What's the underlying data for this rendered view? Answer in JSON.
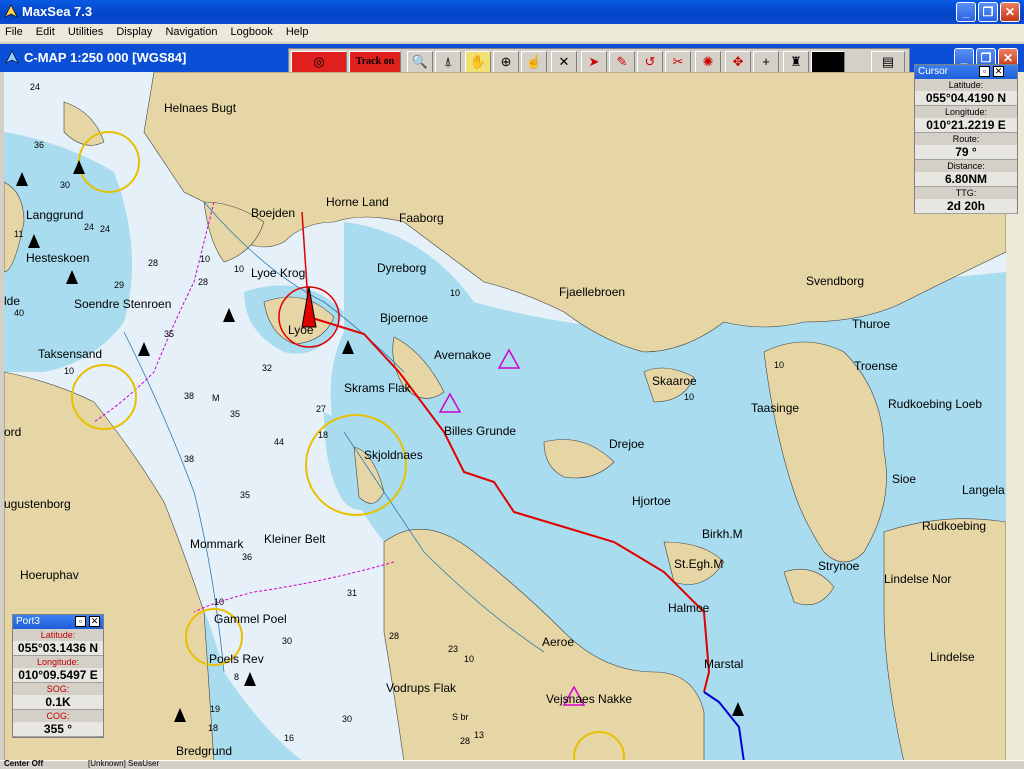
{
  "app": {
    "title": "MaxSea 7.3"
  },
  "menu": [
    "File",
    "Edit",
    "Utilities",
    "Display",
    "Navigation",
    "Logbook",
    "Help"
  ],
  "chart_window": {
    "title": "C-MAP  1:250 000 [WGS84]"
  },
  "toolbar": {
    "track_label": "Track on"
  },
  "cursor_panel": {
    "title": "Cursor",
    "lat_label": "Latitude:",
    "lat": "055°04.4190 N",
    "lon_label": "Longitude:",
    "lon": "010°21.2219 E",
    "route_label": "Route:",
    "route": "79 °",
    "dist_label": "Distance:",
    "dist": "6.80NM",
    "ttg_label": "TTG:",
    "ttg": "2d 20h"
  },
  "port_panel": {
    "title": "Port3",
    "lat_label": "Latitude:",
    "lat": "055°03.1436 N",
    "lon_label": "Longitude:",
    "lon": "010°09.5497 E",
    "sog_label": "SOG:",
    "sog": "0.1K",
    "cog_label": "COG:",
    "cog": "355 °"
  },
  "status": {
    "left": "Center Off",
    "user": "[Unknown] SeaUser"
  },
  "places": {
    "helnaes_bugt": "Helnaes Bugt",
    "horne_land": "Horne Land",
    "faaborg": "Faaborg",
    "boejden": "Boejden",
    "lyoe_krog": "Lyoe Krog",
    "lyoe": "Lyoe",
    "dyreborg": "Dyreborg",
    "bjoernoe": "Bjoernoe",
    "fjaellebroen": "Fjaellebroen",
    "svendborg": "Svendborg",
    "thuroe": "Thuroe",
    "troense": "Troense",
    "avernakoe": "Avernakoe",
    "skaaroe": "Skaaroe",
    "taasinge": "Taasinge",
    "rudkoebing_loeb": "Rudkoebing Loeb",
    "skrams_flak": "Skrams Flak",
    "billes_grunde": "Billes Grunde",
    "drejoe": "Drejoe",
    "skjoldnaes": "Skjoldnaes",
    "hjortoe": "Hjortoe",
    "sioe": "Sioe",
    "langela": "Langela",
    "birkh": "Birkh.M",
    "st_egh": "St.Egh.M",
    "strynoe": "Strynoe",
    "rudkoebing": "Rudkoebing",
    "lindelse_nor": "Lindelse Nor",
    "halmoe": "Halmoe",
    "aeroe": "Aeroe",
    "marstal": "Marstal",
    "lindelse": "Lindelse",
    "vejsnaes_nakke": "Vejsnaes Nakke",
    "vodrups_flak": "Vodrups Flak",
    "langgrund": "Langgrund",
    "hesteskoen": "Hesteskoen",
    "soendre_stenroen": "Soendre Stenroen",
    "taksensand": "Taksensand",
    "ord": "ord",
    "augustenborg": "ugustenborg",
    "mommark": "Mommark",
    "kleiner_belt": "Kleiner Belt",
    "hoeruphav": "Hoeruphav",
    "gammel_poel": "Gammel Poel",
    "poels_rev": "Poels Rev",
    "bredgrund": "Bredgrund",
    "lde": "lde"
  },
  "depths": [
    "24",
    "36",
    "30",
    "24",
    "11",
    "24",
    "29",
    "28",
    "40",
    "28",
    "35",
    "32",
    "38",
    "35",
    "27",
    "44",
    "38",
    "35",
    "36",
    "31",
    "28",
    "30",
    "23",
    "18",
    "16",
    "30",
    "13",
    "8",
    "S br",
    "28",
    "19",
    "18",
    "M"
  ],
  "contours": [
    "10",
    "10",
    "10",
    "10",
    "10",
    "10",
    "10",
    "10"
  ]
}
